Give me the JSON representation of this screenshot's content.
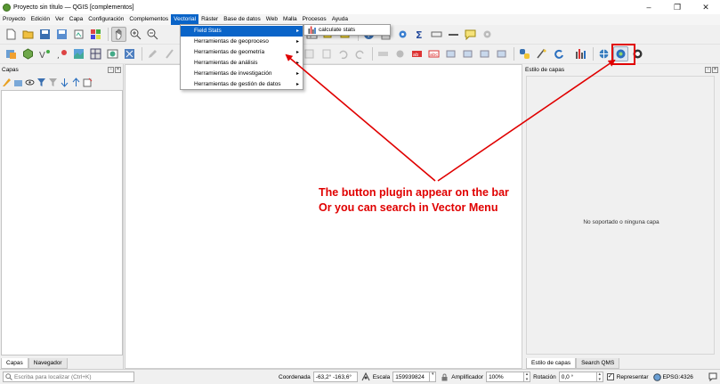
{
  "window": {
    "title": "Proyecto sin título — QGIS [complementos]",
    "controls": [
      "–",
      "❐",
      "✕"
    ]
  },
  "menubar": {
    "items": [
      "Proyecto",
      "Edición",
      "Ver",
      "Capa",
      "Configuración",
      "Complementos",
      "Vectorial",
      "Ráster",
      "Base de datos",
      "Web",
      "Malla",
      "Procesos",
      "Ayuda"
    ],
    "active": "Vectorial"
  },
  "vector_menu": {
    "items": [
      {
        "label": "Field Stats",
        "has_submenu": true,
        "highlighted": true
      },
      {
        "label": "Herramientas de geoproceso",
        "has_submenu": true
      },
      {
        "label": "Herramientas de geometría",
        "has_submenu": true
      },
      {
        "label": "Herramientas de análisis",
        "has_submenu": true
      },
      {
        "label": "Herramientas de investigación",
        "has_submenu": true
      },
      {
        "label": "Herramientas de gestión de datos",
        "has_submenu": true
      }
    ],
    "submenu": {
      "label": "calculate stats",
      "icon": "field-stats-icon"
    }
  },
  "layers_panel": {
    "title": "Capas",
    "tabs": [
      "Capas",
      "Navegador"
    ],
    "selected_tab": "Capas"
  },
  "style_panel": {
    "title": "Estilo de capas",
    "message": "No soportado o ninguna capa",
    "tabs": [
      "Estilo de capas",
      "Search QMS"
    ],
    "selected_tab": "Estilo de capas"
  },
  "statusbar": {
    "locator_placeholder": "Escriba para localizar (Ctrl+K)",
    "coordinate_label": "Coordenada",
    "coordinate_value": "-63,2°  -163,6°",
    "scale_label": "Escala",
    "scale_value": "159939824",
    "magnifier_label": "Amplificador",
    "magnifier_value": "100%",
    "rotation_label": "Rotación",
    "rotation_value": "0,0 °",
    "render_label": "Representar",
    "render_checked": "✓",
    "crs": "EPSG:4326"
  },
  "annotation": {
    "line1": "The button plugin appear on the bar",
    "line2": "Or you can search in Vector Menu",
    "color": "#e00000"
  },
  "colors": {
    "accent": "#0a64c8",
    "qgis_green": "#589632",
    "annotation_red": "#e00000"
  }
}
